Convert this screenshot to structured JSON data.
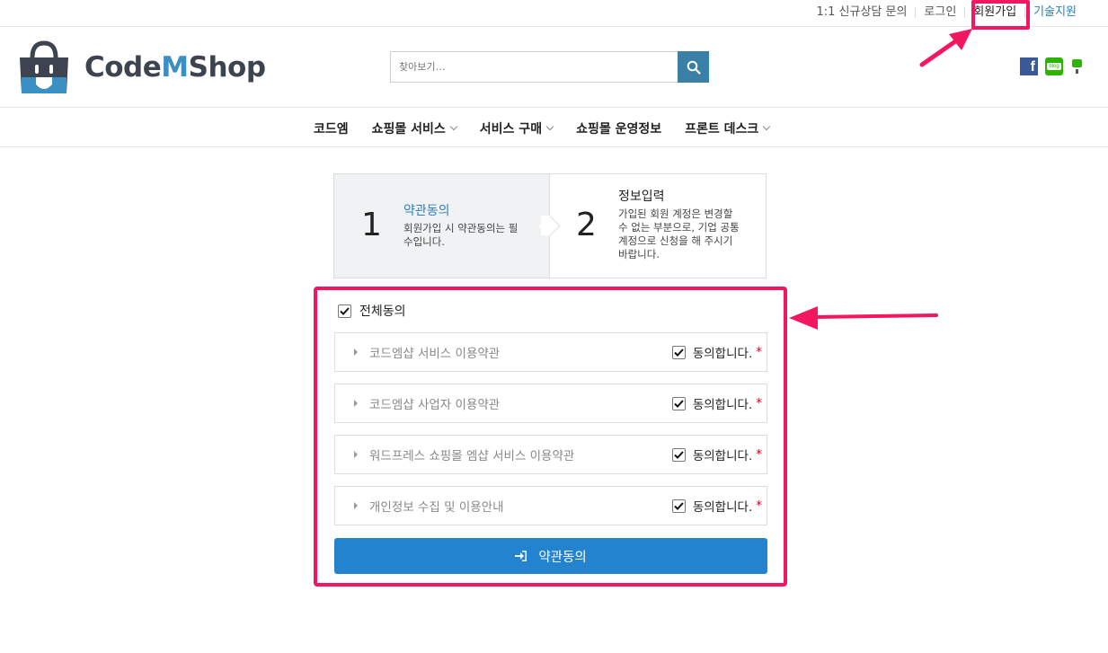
{
  "topbar": {
    "links": [
      "1:1 신규상담 문의",
      "로그인",
      "회원가입",
      "기술지원"
    ]
  },
  "header": {
    "logo_text_1": "Code",
    "logo_text_m": "M",
    "logo_text_2": "Shop",
    "search_placeholder": "찾아보기…"
  },
  "social": {
    "blog_label": "blog"
  },
  "nav": {
    "items": [
      "코드엠",
      "쇼핑몰 서비스",
      "서비스 구매",
      "쇼핑몰 운영정보",
      "프론트 데스크"
    ]
  },
  "steps": [
    {
      "number": "1",
      "title": "약관동의",
      "desc": "회원가입 시 약관동의는 필수입니다."
    },
    {
      "number": "2",
      "title": "정보입력",
      "desc": "가입된 회원 계정은 변경할 수 없는 부분으로, 기업 공통 계정으로 신청을 해 주시기 바랍니다."
    }
  ],
  "agreement": {
    "all_label": "전체동의",
    "agree_label": "동의합니다.",
    "required_mark": "*",
    "terms": [
      "코드엠샵 서비스 이용약관",
      "코드엠샵 사업자 이용약관",
      "워드프레스 쇼핑몰 엠샵 서비스 이용약관",
      "개인정보 수집 및 이용안내"
    ],
    "submit_label": "약관동의"
  },
  "colors": {
    "highlight": "#f3175f",
    "primary": "#2383cf",
    "accent_text": "#2b7fbf"
  }
}
